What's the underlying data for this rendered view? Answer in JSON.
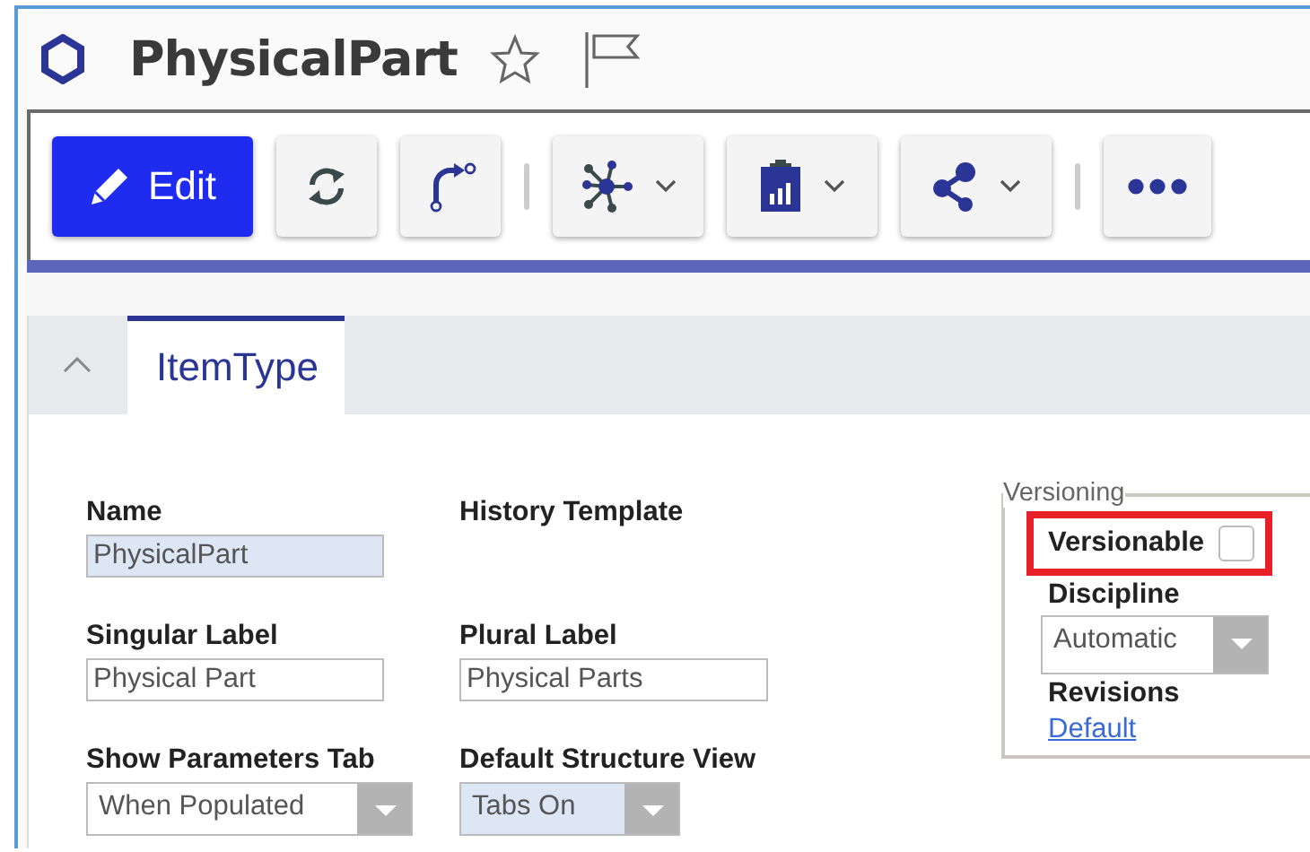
{
  "title": "PhysicalPart",
  "toolbar": [
    {
      "kind": "primary",
      "label": "Edit"
    },
    {
      "kind": "icon"
    },
    {
      "kind": "icon"
    },
    {
      "kind": "separator"
    },
    {
      "kind": "menu"
    },
    {
      "kind": "menu"
    },
    {
      "kind": "menu"
    },
    {
      "kind": "separator"
    },
    {
      "kind": "icon"
    }
  ],
  "panel": {
    "expanded": true,
    "tabs": [
      {
        "label": "ItemType",
        "selected": true
      }
    ]
  },
  "fields": [
    {
      "label": "Name",
      "kind": "text",
      "value": "PhysicalPart",
      "required": true
    },
    {
      "label": "History Template",
      "kind": "empty"
    },
    {
      "label": "Singular Label",
      "kind": "text",
      "value": "Physical Part",
      "required": false
    },
    {
      "label": "Plural Label",
      "kind": "text",
      "value": "Physical Parts",
      "required": false
    },
    {
      "label": "Show Parameters Tab",
      "kind": "select",
      "value": "When Populated",
      "required": false
    },
    {
      "label": "Default Structure View",
      "kind": "select",
      "value": "Tabs On",
      "required": true
    }
  ],
  "versioning": {
    "legend": "Versioning",
    "versionable": {
      "label": "Versionable",
      "checked": false,
      "highlighted": true
    },
    "discipline": {
      "label": "Discipline",
      "value": "Automatic"
    },
    "revisions": {
      "label": "Revisions",
      "link": "Default"
    }
  }
}
